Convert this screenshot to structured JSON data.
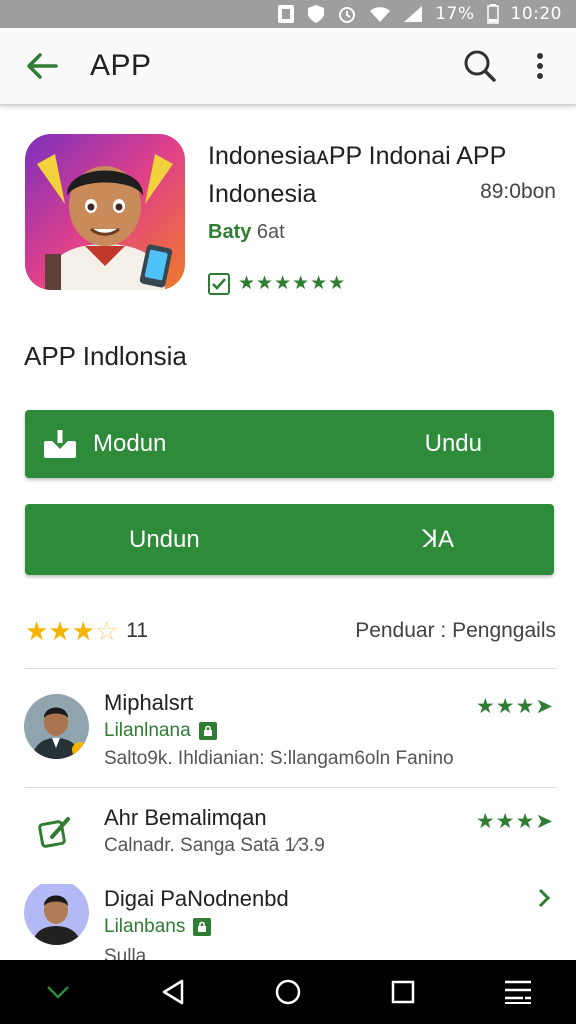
{
  "status_bar": {
    "battery": "17%",
    "time": "10:20"
  },
  "app_bar": {
    "title": "APP",
    "back_icon": "arrow-left-icon",
    "search_icon": "search-icon",
    "more_icon": "more-vert-icon"
  },
  "header": {
    "app_name": "Indonesia APP Indonai APP Indonesia",
    "app_name_line1": "IndonesiaᴀPP Indonai APP",
    "app_name_line2": "Indonesia",
    "size": "89:0bon",
    "developer_green": "Baty",
    "developer_grey": "6at",
    "stars": "★★★★★★"
  },
  "section": {
    "title": "APP Indlonsia"
  },
  "buttons": {
    "primary_left": "Modun",
    "primary_right": "Undu",
    "secondary_left": "Undun",
    "secondary_right": "ꓘA"
  },
  "rating": {
    "count": "11",
    "right_text": "Penduar : Pengngails",
    "value": 3.5,
    "max": 5
  },
  "reviews": [
    {
      "name": "Miphalsrt",
      "tag": "Lilanlnana",
      "text": "Salto9k. Ihldianian: S:llangam6oln Fanino",
      "stars": "★★★➤"
    },
    {
      "name": "Ahr Bemalimqan",
      "text": "Calnadr. Sanga Satā 1⁄3.9",
      "stars": "★★★➤"
    },
    {
      "name": "Digai PaNodnenbd",
      "tag": "Lilanbans",
      "text": "Sulla"
    }
  ],
  "colors": {
    "accent": "#2e8b3a",
    "star_gold": "#f4b400",
    "status_bar": "#9e9e9e"
  }
}
